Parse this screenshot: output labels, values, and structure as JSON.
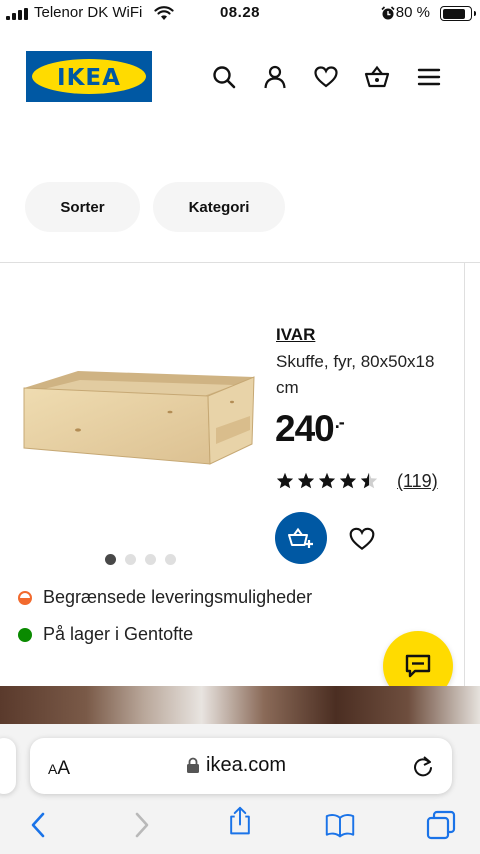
{
  "status_bar": {
    "carrier": "Telenor DK WiFi",
    "time": "08.28",
    "battery": "80 %",
    "icons": [
      "signal-icon",
      "wifi-icon",
      "alarm-icon",
      "battery-icon"
    ]
  },
  "header": {
    "logo_text": "IKEA",
    "icons": [
      "search-icon",
      "profile-icon",
      "heart-icon",
      "basket-icon",
      "menu-icon"
    ]
  },
  "filters": {
    "sort_label": "Sorter",
    "category_label": "Kategori"
  },
  "product": {
    "name": "IVAR",
    "description": "Skuffe, fyr, 80x50x18 cm",
    "price": "240",
    "price_suffix": ".-",
    "rating": 4.5,
    "reviews": "(119)",
    "image_count": 4,
    "image_index": 1
  },
  "availability": {
    "delivery": "Begrænsede leveringsmuligheder",
    "delivery_color": "#f26a2e",
    "stock": "På lager i Gentofte",
    "stock_color": "#0a8a00"
  },
  "colors": {
    "brand_blue": "#0058a3",
    "brand_yellow": "#ffdb00"
  },
  "browser": {
    "aa_label_small": "A",
    "aa_label_big": "A",
    "url": "ikea.com"
  }
}
